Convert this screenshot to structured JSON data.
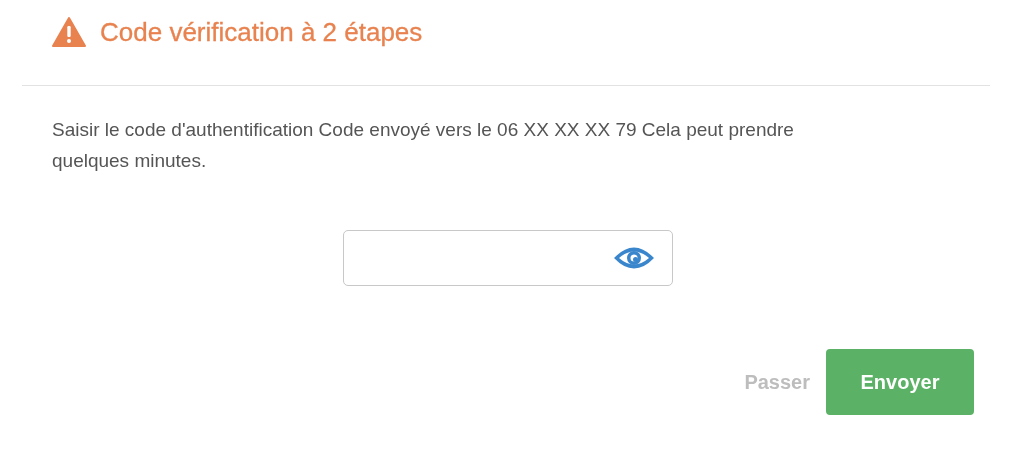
{
  "title": "Code vérification à 2 étapes",
  "message": "Saisir le code d'authentification Code envoyé vers le 06 XX XX XX 79 Cela peut prendre quelques minutes.",
  "buttons": [
    {
      "label": "Passer",
      "kind": "link"
    },
    {
      "label": "Envoyer",
      "kind": "primary"
    }
  ]
}
